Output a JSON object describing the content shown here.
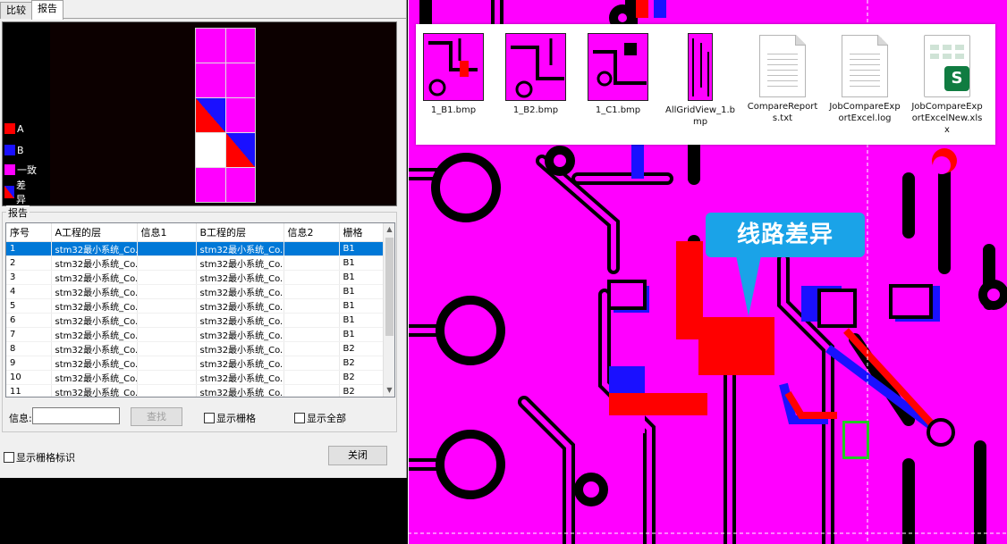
{
  "tabs": [
    {
      "label": "比较"
    },
    {
      "label": "报告"
    }
  ],
  "legend": [
    {
      "label": "A",
      "color": "#ff0000"
    },
    {
      "label": "B",
      "color": "#1a10ff"
    },
    {
      "label": "一致",
      "color": "#ff00ff"
    },
    {
      "label": "差异",
      "color": "diagonal"
    }
  ],
  "report": {
    "group_title": "报告",
    "columns": [
      "序号",
      "A工程的层",
      "信息1",
      "B工程的层",
      "信息2",
      "栅格"
    ],
    "rows": [
      [
        "1",
        "stm32最小系统_Co...",
        "",
        "stm32最小系统_Co...",
        "",
        "B1"
      ],
      [
        "2",
        "stm32最小系统_Co...",
        "",
        "stm32最小系统_Co...",
        "",
        "B1"
      ],
      [
        "3",
        "stm32最小系统_Co...",
        "",
        "stm32最小系统_Co...",
        "",
        "B1"
      ],
      [
        "4",
        "stm32最小系统_Co...",
        "",
        "stm32最小系统_Co...",
        "",
        "B1"
      ],
      [
        "5",
        "stm32最小系统_Co...",
        "",
        "stm32最小系统_Co...",
        "",
        "B1"
      ],
      [
        "6",
        "stm32最小系统_Co...",
        "",
        "stm32最小系统_Co...",
        "",
        "B1"
      ],
      [
        "7",
        "stm32最小系统_Co...",
        "",
        "stm32最小系统_Co...",
        "",
        "B1"
      ],
      [
        "8",
        "stm32最小系统_Co...",
        "",
        "stm32最小系统_Co...",
        "",
        "B2"
      ],
      [
        "9",
        "stm32最小系统_Co...",
        "",
        "stm32最小系统_Co...",
        "",
        "B2"
      ],
      [
        "10",
        "stm32最小系统_Co...",
        "",
        "stm32最小系统_Co...",
        "",
        "B2"
      ],
      [
        "11",
        "stm32最小系统_Co...",
        "",
        "stm32最小系统_Co...",
        "",
        "B2"
      ]
    ],
    "selected_row": 0
  },
  "search": {
    "info_label": "信息:",
    "info_value": "",
    "find_label": "查找",
    "show_grid_label": "显示栅格",
    "show_all_label": "显示全部"
  },
  "footer": {
    "show_grid_mark_label": "显示栅格标识",
    "close_label": "关闭"
  },
  "files": [
    {
      "name": "1_B1.bmp",
      "icon": "bmp-thumbnail"
    },
    {
      "name": "1_B2.bmp",
      "icon": "bmp-thumbnail"
    },
    {
      "name": "1_C1.bmp",
      "icon": "bmp-thumbnail"
    },
    {
      "name": "AllGridView_1.bmp",
      "icon": "bmp-thumbnail"
    },
    {
      "name": "CompareReports.txt",
      "icon": "text-file-icon"
    },
    {
      "name": "JobCompareExportExcel.log",
      "icon": "text-file-icon"
    },
    {
      "name": "JobCompareExportExcelNew.xlsx",
      "icon": "excel-file-icon",
      "badge": "S"
    }
  ],
  "callout": {
    "text": "线路差异"
  },
  "colors": {
    "a_layer": "#ff0000",
    "b_layer": "#1a10ff",
    "same": "#ff00ff",
    "highlight": "#22cc22",
    "callout": "#1aa3e8"
  }
}
